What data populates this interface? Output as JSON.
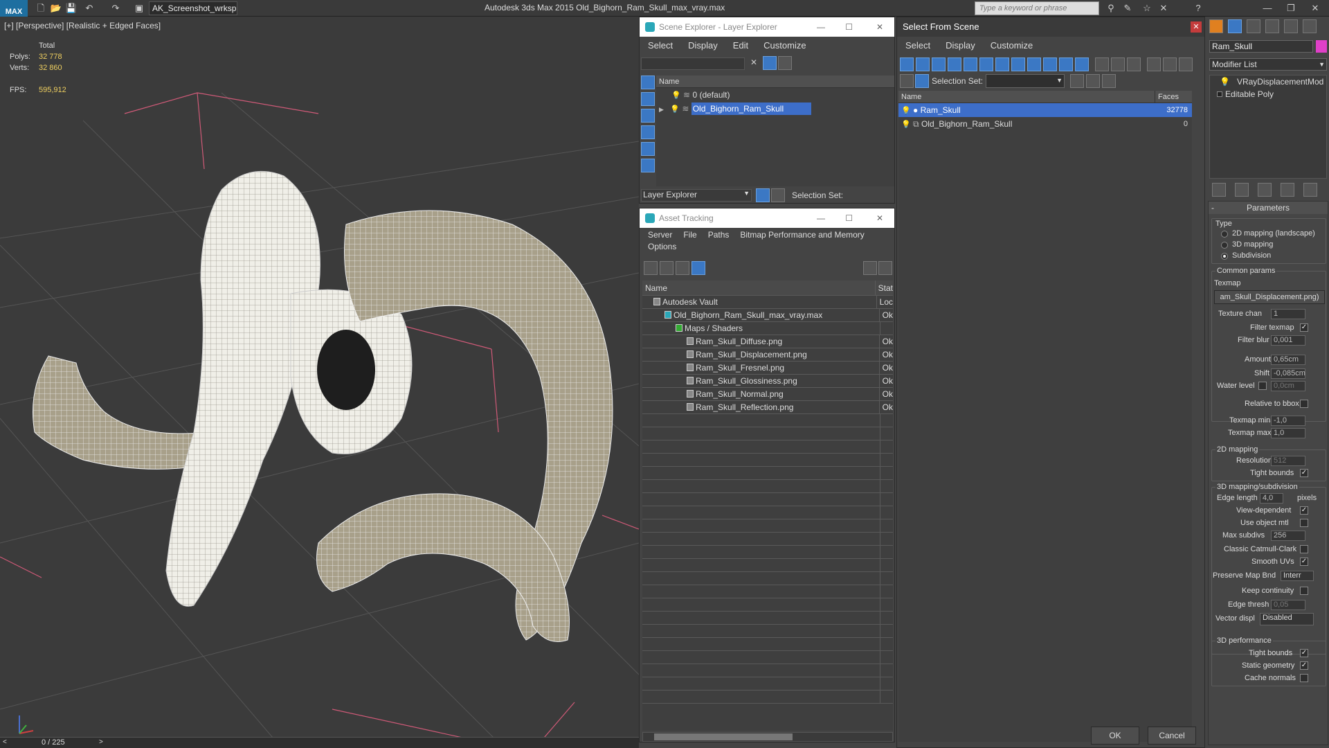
{
  "app": {
    "logo": "MAX",
    "workspace": "AK_Screenshot_wrksp",
    "title": "Autodesk 3ds Max  2015    Old_Bighorn_Ram_Skull_max_vray.max",
    "search_placeholder": "Type a keyword or phrase"
  },
  "viewport": {
    "label": "[+] [Perspective] [Realistic + Edged Faces]",
    "stats": {
      "total_label": "Total",
      "polys_label": "Polys:",
      "polys": "32 778",
      "verts_label": "Verts:",
      "verts": "32 860",
      "fps_label": "FPS:",
      "fps": "595,912"
    },
    "timeline": "0 / 225"
  },
  "scene_explorer": {
    "title": "Scene Explorer - Layer Explorer",
    "menu": [
      "Select",
      "Display",
      "Edit",
      "Customize"
    ],
    "col_name": "Name",
    "layers": [
      {
        "name": "0 (default)",
        "selected": false
      },
      {
        "name": "Old_Bighorn_Ram_Skull",
        "selected": true
      }
    ],
    "footer_dropdown": "Layer Explorer",
    "footer_selset": "Selection Set:"
  },
  "asset_tracking": {
    "title": "Asset Tracking",
    "menu": [
      "Server",
      "File",
      "Paths",
      "Bitmap Performance and Memory"
    ],
    "menu2": "Options",
    "col_name": "Name",
    "col_status": "Stat",
    "rows": [
      {
        "name": "Autodesk Vault",
        "status": "Loc",
        "indent": 1
      },
      {
        "name": "Old_Bighorn_Ram_Skull_max_vray.max",
        "status": "Ok",
        "indent": 2
      },
      {
        "name": "Maps / Shaders",
        "status": "",
        "indent": 3
      },
      {
        "name": "Ram_Skull_Diffuse.png",
        "status": "Ok",
        "indent": 4
      },
      {
        "name": "Ram_Skull_Displacement.png",
        "status": "Ok",
        "indent": 4
      },
      {
        "name": "Ram_Skull_Fresnel.png",
        "status": "Ok",
        "indent": 4
      },
      {
        "name": "Ram_Skull_Glossiness.png",
        "status": "Ok",
        "indent": 4
      },
      {
        "name": "Ram_Skull_Normal.png",
        "status": "Ok",
        "indent": 4
      },
      {
        "name": "Ram_Skull_Reflection.png",
        "status": "Ok",
        "indent": 4
      }
    ]
  },
  "select_from_scene": {
    "title": "Select From Scene",
    "menu": [
      "Select",
      "Display",
      "Customize"
    ],
    "selset_label": "Selection Set:",
    "col_name": "Name",
    "col_faces": "Faces",
    "rows": [
      {
        "name": "Ram_Skull",
        "faces": "32778",
        "selected": true
      },
      {
        "name": "Old_Bighorn_Ram_Skull",
        "faces": "0",
        "selected": false
      }
    ],
    "ok": "OK",
    "cancel": "Cancel"
  },
  "command_panel": {
    "object_name": "Ram_Skull",
    "object_color": "#e040c8",
    "modifier_list": "Modifier List",
    "stack": [
      "VRayDisplacementMod",
      "Editable Poly"
    ],
    "rollout": "Parameters",
    "type_label": "Type",
    "types": [
      "2D mapping (landscape)",
      "3D mapping",
      "Subdivision"
    ],
    "common": "Common params",
    "texmap_label": "Texmap",
    "texmap": "am_Skull_Displacement.png)",
    "texture_chan_label": "Texture chan",
    "texture_chan": "1",
    "filter_texmap_label": "Filter texmap",
    "filter_blur_label": "Filter blur",
    "filter_blur": "0,001",
    "amount_label": "Amount",
    "amount": "0,65cm",
    "shift_label": "Shift",
    "shift": "-0,085cm",
    "water_label": "Water level",
    "water": "0,0cm",
    "relbbox_label": "Relative to bbox",
    "texmin_label": "Texmap min",
    "texmin": "-1,0",
    "texmax_label": "Texmap max",
    "texmax": "1,0",
    "map2d": "2D mapping",
    "resolution_label": "Resolution",
    "resolution": "512",
    "tight1_label": "Tight bounds",
    "map3d": "3D mapping/subdivision",
    "edge_len_label": "Edge length",
    "edge_len": "4,0",
    "pixels": "pixels",
    "viewdep_label": "View-dependent",
    "useobj_label": "Use object mtl",
    "maxsub_label": "Max subdivs",
    "maxsub": "256",
    "catmull_label": "Classic Catmull-Clark",
    "smoothuv_label": "Smooth UVs",
    "preserve_label": "Preserve Map Bnd",
    "preserve": "Interr",
    "keepcont_label": "Keep continuity",
    "edgethresh_label": "Edge thresh",
    "edgethresh": "0,05",
    "vector_label": "Vector displ",
    "vector": "Disabled",
    "perf": "3D performance",
    "tight2_label": "Tight bounds",
    "static_label": "Static geometry",
    "cache_label": "Cache normals"
  }
}
